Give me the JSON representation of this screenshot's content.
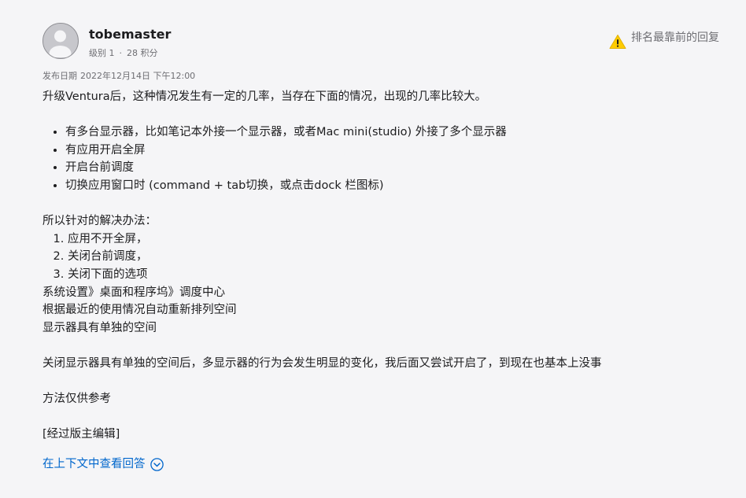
{
  "author": {
    "username": "tobemaster",
    "level": "级别 1",
    "separator": "·",
    "points": "28 积分"
  },
  "top_reply_label": "排名最靠前的回复",
  "post_date": {
    "label": "发布日期",
    "value": "2022年12月14日 下午12:00"
  },
  "body": {
    "intro": "升级Ventura后，这种情况发生有一定的几率，当存在下面的情况，出现的几率比较大。",
    "conditions": [
      "有多台显示器，比如笔记本外接一个显示器，或者Mac mini(studio) 外接了多个显示器",
      "有应用开启全屏",
      "开启台前调度",
      "切换应用窗口时 (command + tab切换，或点击dock 栏图标)"
    ],
    "solution_heading": "所以针对的解决办法：",
    "solutions": [
      "应用不开全屏，",
      "关闭台前调度，",
      "关闭下面的选项"
    ],
    "settings_path": [
      "系统设置》桌面和程序坞》调度中心",
      "根据最近的使用情况自动重新排列空间",
      "显示器具有单独的空间"
    ],
    "followup": "关闭显示器具有单独的空间后，多显示器的行为会发生明显的变化，我后面又尝试开启了，到现在也基本上没事",
    "disclaimer": "方法仅供参考",
    "edited_note": "[经过版主编辑]"
  },
  "context_link": "在上下文中查看回答",
  "icons": {
    "avatar": "avatar-icon",
    "warning": "warning-icon",
    "chevron": "chevron-down-circle-icon"
  },
  "colors": {
    "link": "#0066cc",
    "warning": "#ffcc00",
    "background": "#f5f5f7"
  }
}
